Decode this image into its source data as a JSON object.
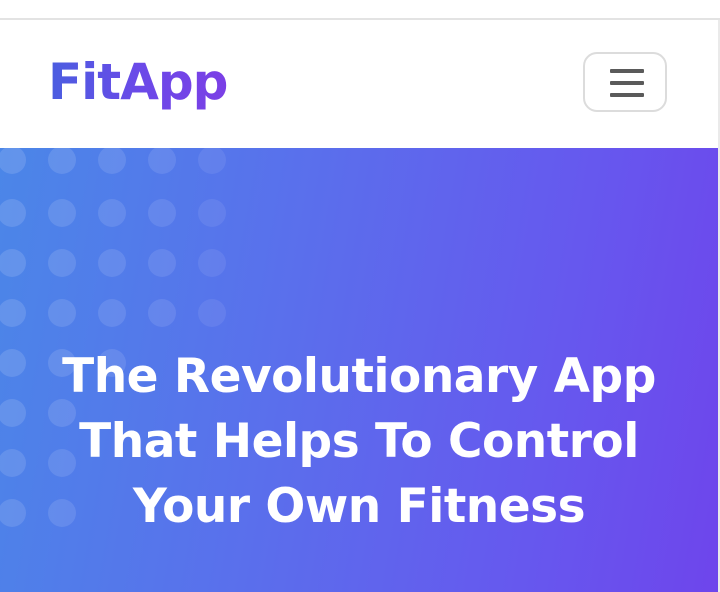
{
  "navbar": {
    "brand": "FitApp",
    "menu_button_icon": "hamburger-menu-icon"
  },
  "hero": {
    "title_lines": [
      "The Revolutionary App",
      "That Helps To Control",
      "Your Own Fitness"
    ]
  },
  "colors": {
    "brand_gradient_start": "#4a5ee0",
    "brand_gradient_end": "#7b3fe6",
    "hero_gradient_start": "#4b86e8",
    "hero_gradient_end": "#6e45ec",
    "hero_text": "#ffffff",
    "menu_icon": "#5a5a5a"
  }
}
